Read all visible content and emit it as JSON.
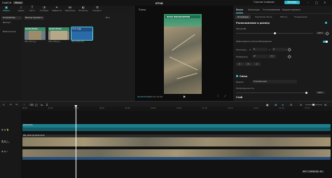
{
  "titlebar": {
    "app_name": "CapCut",
    "menu_label": "Меню",
    "project_title": "0718",
    "shortcuts_label": "Горячие клавиши",
    "export_label": "Экспорт",
    "window_controls": [
      "minimize-icon",
      "maximize-icon",
      "close-icon"
    ]
  },
  "toolbar": {
    "tools": [
      {
        "label": "Медиа",
        "icon": "media-icon",
        "active": true
      },
      {
        "label": "Аудио",
        "icon": "audio-icon",
        "active": false
      },
      {
        "label": "Текст",
        "icon": "text-icon",
        "active": false
      },
      {
        "label": "Стикеры",
        "icon": "sticker-icon",
        "active": false
      },
      {
        "label": "Эффекты",
        "icon": "effects-icon",
        "active": false
      },
      {
        "label": "Переходы",
        "icon": "transitions-icon",
        "active": false
      },
      {
        "label": "Фильтры",
        "icon": "filters-icon",
        "active": false
      },
      {
        "label": "Коррект.",
        "icon": "adjust-icon",
        "active": false
      }
    ]
  },
  "sidebar": {
    "items": [
      {
        "label": "Устройство",
        "active": true
      },
      {
        "label": "Импорт",
        "active": false
      },
      {
        "label": "Библиотека",
        "active": false
      }
    ]
  },
  "media": {
    "import_label": "Импортировать",
    "tools_label": "Все",
    "thumbs": [
      {
        "caption": "ВЫЧИСЛЕНИЯ",
        "name": "IMG_0127.jpg",
        "color": "#6d7b84"
      },
      {
        "caption": "ВЫЧИСЛЕНИЯ",
        "name": "IMG_0128.jpg",
        "color": "#8c8a7e"
      },
      {
        "caption": "Стоп кадр",
        "name": "IMG_0129.mp4",
        "color": "#1f4f86"
      }
    ]
  },
  "player": {
    "title": "Плеер",
    "banner_text": "ФУХА ВЫЧИСЛЕНИЯ",
    "timecode": "00:00:03:20",
    "duration": "00:01:02:20"
  },
  "inspector": {
    "tabs": [
      {
        "label": "Видео",
        "active": true
      },
      {
        "label": "Анимация",
        "active": false
      },
      {
        "label": "Отслеживание",
        "active": false
      },
      {
        "label": "Корректировка",
        "active": false
      }
    ],
    "subtabs": [
      {
        "label": "Основные",
        "active": true
      },
      {
        "label": "Удаление фона",
        "active": false
      },
      {
        "label": "Маска",
        "active": false
      },
      {
        "label": "Повышение",
        "active": false
      }
    ],
    "position_section": "Расположение и размер",
    "scale_label": "Масштаб",
    "scale_value": "100%",
    "scale_fraction": 0.5,
    "uniform_label": "Равномерное масштабирование",
    "position_label": "Положен...",
    "pos_x_label": "X",
    "pos_x_value": "0",
    "pos_y_label": "Y",
    "pos_y_value": "0",
    "rotate_label": "Повернуть",
    "rotate_value": "0°",
    "blend_section": "Смеш",
    "blend_mode_label": "Режим",
    "blend_mode_value": "Нормальный",
    "opacity_label": "Непрозрачность",
    "opacity_value": "100%",
    "opacity_fraction": 1.0,
    "stabilize_section": "Стаб",
    "accent_color": "#2bb6c9"
  },
  "timeline": {
    "tool_icons": [
      "select-icon",
      "undo-icon",
      "redo-icon",
      "split-icon",
      "delete-icon",
      "freeze-icon",
      "mirror-icon",
      "crop-icon"
    ],
    "right_icons": [
      "mic-icon",
      "magnet-icon",
      "link-icon",
      "preview-icon",
      "zoom-out-icon",
      "zoom-in-icon"
    ],
    "ruler_ticks": [
      "00:00",
      "00:10",
      "00:20",
      "00:30",
      "00:40",
      "00:50",
      "01:00",
      "01:10",
      "01:20",
      "01:30",
      "01:40",
      "01:50"
    ],
    "track_labels": [
      "Обложка",
      ""
    ],
    "clip_labels": {
      "top_clip": "00:01:02:20",
      "main_clip": "IMG_0129.mp4  00:01:02:20"
    }
  },
  "watermark": "IRECOMMEND.RU"
}
